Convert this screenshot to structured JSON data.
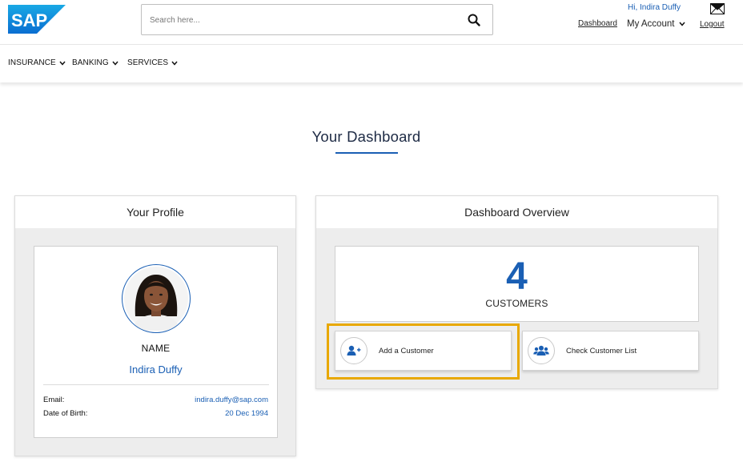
{
  "header": {
    "logo_text": "SAP",
    "search_placeholder": "Search here...",
    "greeting": "Hi, Indira Duffy",
    "dashboard_link": "Dashboard",
    "my_account": "My Account",
    "logout": "Logout"
  },
  "nav": {
    "items": [
      {
        "label": "INSURANCE"
      },
      {
        "label": "BANKING"
      },
      {
        "label": "SERVICES"
      }
    ]
  },
  "page": {
    "title": "Your Dashboard"
  },
  "profile": {
    "header": "Your Profile",
    "name_label": "NAME",
    "name": "Indira Duffy",
    "email_label": "Email:",
    "email": "indira.duffy@sap.com",
    "dob_label": "Date of Birth:",
    "dob": "20 Dec 1994"
  },
  "overview": {
    "header": "Dashboard Overview",
    "count": "4",
    "count_label": "CUSTOMERS",
    "add_customer": "Add a Customer",
    "check_list": "Check Customer List"
  },
  "colors": {
    "accent": "#1a5fb4",
    "highlight": "#e8a800",
    "logo_blue": "#0a6ed1"
  }
}
